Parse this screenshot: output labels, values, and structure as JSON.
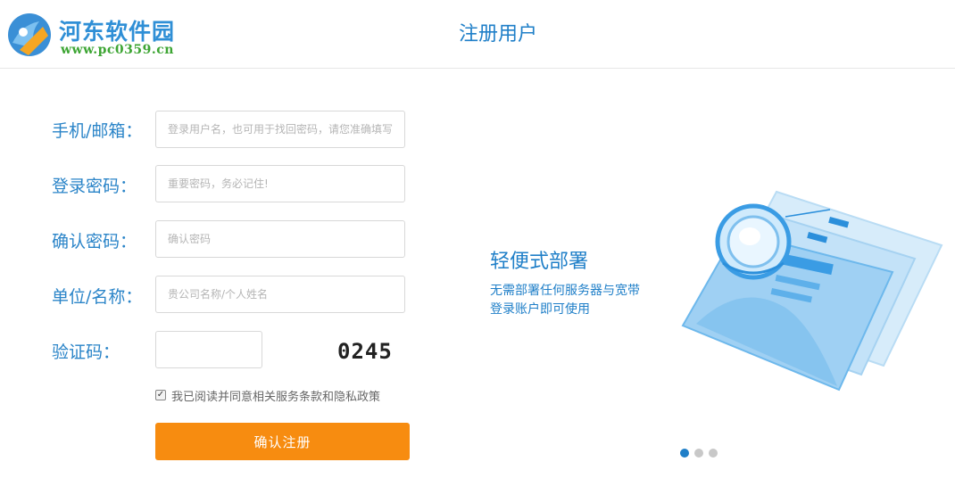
{
  "header": {
    "logo_title": "河东软件园",
    "logo_url": "www.pc0359.cn",
    "page_title": "注册用户"
  },
  "form": {
    "phone_label": "手机/邮箱：",
    "phone_placeholder": "登录用户名，也可用于找回密码，请您准确填写",
    "password_label": "登录密码：",
    "password_placeholder": "重要密码，务必记住!",
    "confirm_label": "确认密码：",
    "confirm_placeholder": "确认密码",
    "company_label": "单位/名称：",
    "company_placeholder": "贵公司名称/个人姓名",
    "captcha_label": "验证码：",
    "captcha_value": "",
    "captcha_image_text": "0245",
    "agree_checked": true,
    "agree_text": "我已阅读并同意相关服务条款和隐私政策",
    "submit_label": "确认注册"
  },
  "promo": {
    "title": "轻便式部署",
    "desc_line1": "无需部署任何服务器与宽带",
    "desc_line2": "登录账户即可使用"
  },
  "carousel": {
    "count": 3,
    "active_index": 0
  },
  "colors": {
    "accent_blue": "#1f7fc8",
    "submit_orange": "#f78c10",
    "logo_green": "#3da533"
  }
}
